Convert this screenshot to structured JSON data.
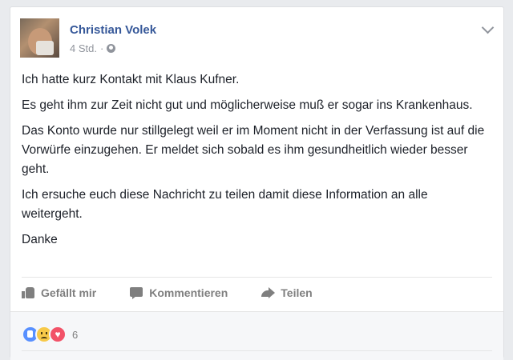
{
  "post": {
    "author": "Christian Volek",
    "timestamp": "4 Std.",
    "separator": "·",
    "privacy_icon": "globe-icon",
    "menu_icon": "chevron-down-icon",
    "paragraphs": [
      "Ich hatte kurz Kontakt mit Klaus Kufner.",
      "Es geht ihm zur Zeit nicht gut und möglicherweise muß er sogar ins Krankenhaus.",
      "Das Konto wurde nur stillgelegt weil er im Moment nicht in der Verfassung ist auf die Vorwürfe einzugehen. Er meldet sich sobald es ihm gesundheitlich wieder besser geht.",
      "Ich ersuche euch diese Nachricht zu teilen damit diese Information an alle weitergeht.",
      "Danke"
    ]
  },
  "actions": {
    "like_label": "Gefällt mir",
    "comment_label": "Kommentieren",
    "share_label": "Teilen"
  },
  "reactions": {
    "types": [
      "like",
      "sad",
      "love"
    ],
    "count": "6"
  },
  "colors": {
    "author": "#365899",
    "muted": "#90949c",
    "action": "#7f7f7f",
    "like": "#5890ff",
    "sad": "#f7c948",
    "love": "#f25268"
  }
}
